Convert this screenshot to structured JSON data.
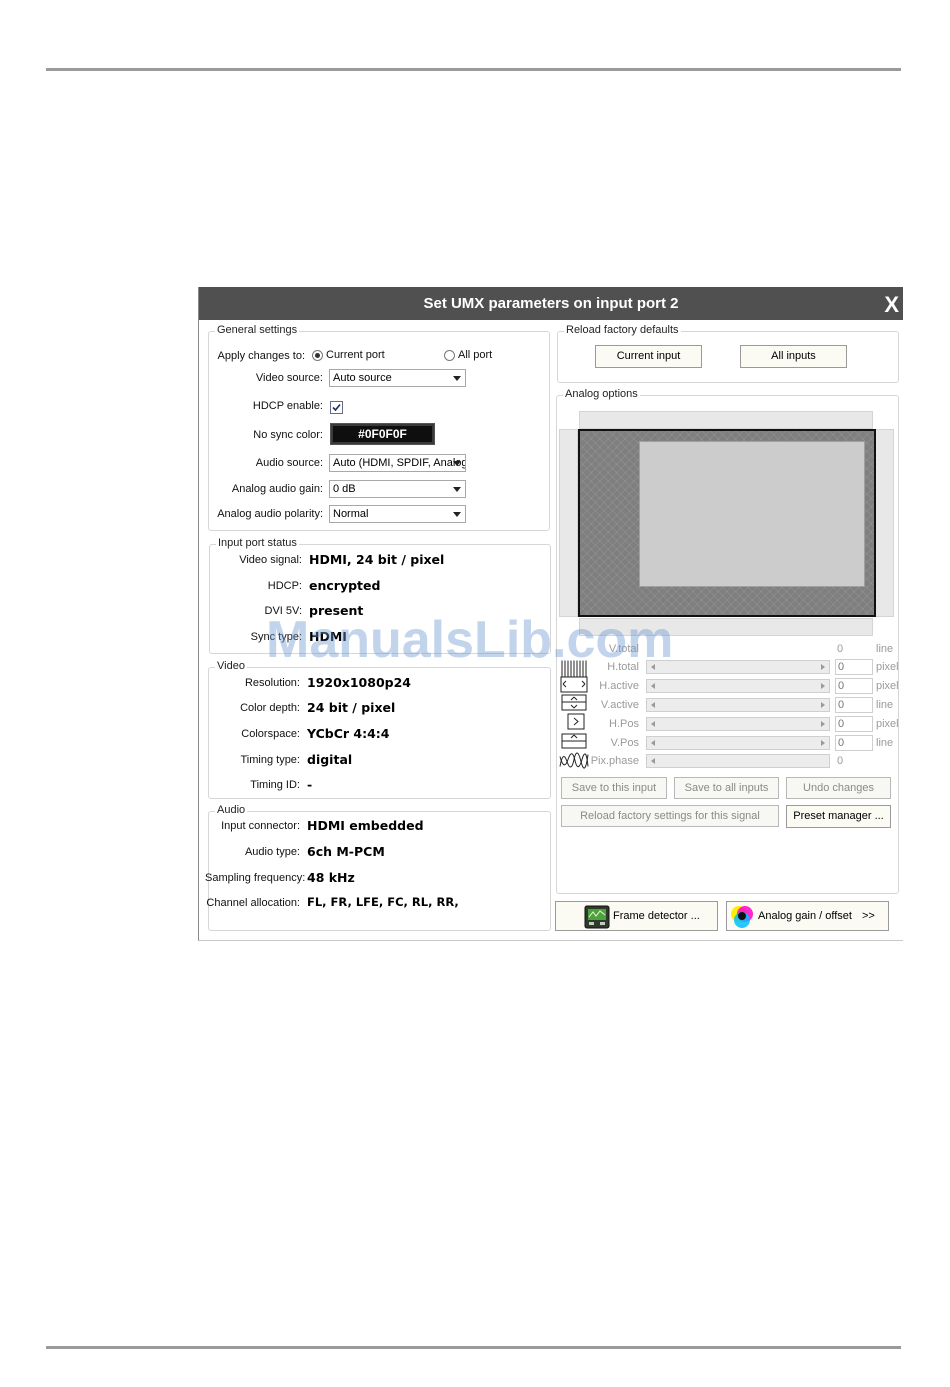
{
  "dialog": {
    "title": "Set UMX parameters on input port 2",
    "close": "X"
  },
  "general": {
    "title": "General settings",
    "apply_label": "Apply changes to:",
    "apply_current": "Current port",
    "apply_all": "All port",
    "video_source_label": "Video source:",
    "video_source": "Auto source",
    "hdcp_label": "HDCP enable:",
    "nosync_label": "No sync color:",
    "nosync_color": "#0F0F0F",
    "audio_source_label": "Audio source:",
    "audio_source": "Auto (HDMI, SPDIF, Analog)",
    "analog_gain_label": "Analog audio gain:",
    "analog_gain": "0 dB",
    "analog_polarity_label": "Analog audio polarity:",
    "analog_polarity": "Normal"
  },
  "status": {
    "title": "Input port status",
    "video_signal_label": "Video signal:",
    "video_signal": "HDMI, 24 bit / pixel",
    "hdcp_label": "HDCP:",
    "hdcp": "encrypted",
    "dvi5v_label": "DVI 5V:",
    "dvi5v": "present",
    "sync_label": "Sync type:",
    "sync": "HDMI"
  },
  "video": {
    "title": "Video",
    "resolution_label": "Resolution:",
    "resolution": "1920x1080p24",
    "color_depth_label": "Color depth:",
    "color_depth": "24 bit / pixel",
    "colorspace_label": "Colorspace:",
    "colorspace": "YCbCr 4:4:4",
    "timing_type_label": "Timing type:",
    "timing_type": "digital",
    "timing_id_label": "Timing ID:",
    "timing_id": "-"
  },
  "audio": {
    "title": "Audio",
    "connector_label": "Input connector:",
    "connector": "HDMI embedded",
    "type_label": "Audio type:",
    "type": "6ch M-PCM",
    "freq_label": "Sampling frequency:",
    "freq": "48 kHz",
    "alloc_label": "Channel allocation:",
    "alloc": "FL, FR, LFE, FC, RL, RR,"
  },
  "reload": {
    "title": "Reload factory defaults",
    "current_input": "Current input",
    "all_inputs": "All inputs"
  },
  "analog": {
    "title": "Analog options",
    "params": [
      {
        "label": "V.total",
        "value": "0",
        "unit": "line"
      },
      {
        "label": "H.total",
        "value": "0",
        "unit": "pixel"
      },
      {
        "label": "H.active",
        "value": "0",
        "unit": "pixel"
      },
      {
        "label": "V.active",
        "value": "0",
        "unit": "line"
      },
      {
        "label": "H.Pos",
        "value": "0",
        "unit": "pixel"
      },
      {
        "label": "V.Pos",
        "value": "0",
        "unit": "line"
      },
      {
        "label": "Pix.phase",
        "value": "0",
        "unit": ""
      }
    ],
    "save_this": "Save to this input",
    "save_all": "Save to all inputs",
    "undo": "Undo changes",
    "reload_signal": "Reload factory settings for this signal",
    "preset": "Preset manager ..."
  },
  "bottom": {
    "frame_detector": "Frame detector ...",
    "analog_gain": "Analog gain / offset",
    "more": ">>"
  },
  "watermark": "ManualsLib.com"
}
